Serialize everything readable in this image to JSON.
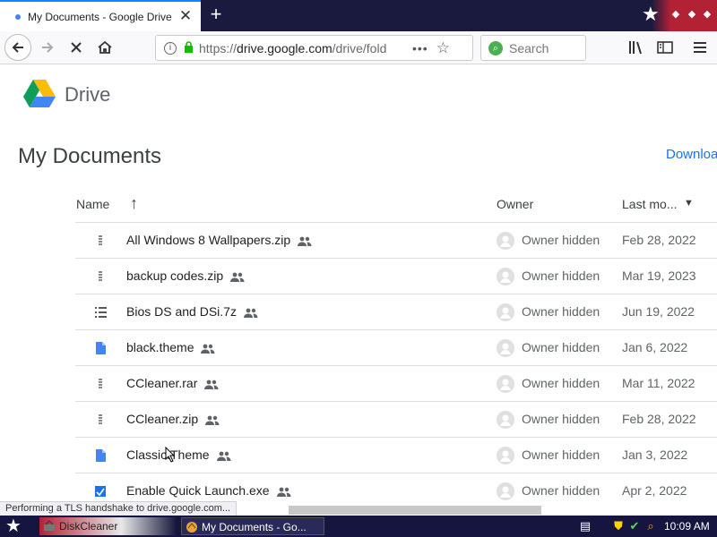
{
  "browser": {
    "tab_title": "My Documents - Google Drive",
    "tab_close": "✕",
    "new_tab": "+",
    "url_prefix": "https://",
    "url_host": "drive.google.com",
    "url_path": "/drive/folde",
    "url_menu": "•••",
    "search_placeholder": "Search"
  },
  "drive": {
    "brand": "Drive",
    "page_title": "My Documents",
    "download_label": "Downloa"
  },
  "columns": {
    "name": "Name",
    "owner": "Owner",
    "last_modified": "Last mo..."
  },
  "files": [
    {
      "name": "All Windows 8 Wallpapers.zip",
      "icon": "zip-icon",
      "owner": "Owner hidden",
      "date": "Feb 28, 2022"
    },
    {
      "name": "backup codes.zip",
      "icon": "zip-icon",
      "owner": "Owner hidden",
      "date": "Mar 19, 2023"
    },
    {
      "name": "Bios DS and DSi.7z",
      "icon": "list-file-icon",
      "owner": "Owner hidden",
      "date": "Jun 19, 2022"
    },
    {
      "name": "black.theme",
      "icon": "doc-icon",
      "owner": "Owner hidden",
      "date": "Jan 6, 2022"
    },
    {
      "name": "CCleaner.rar",
      "icon": "zip-icon",
      "owner": "Owner hidden",
      "date": "Mar 11, 2022"
    },
    {
      "name": "CCleaner.zip",
      "icon": "zip-icon",
      "owner": "Owner hidden",
      "date": "Feb 28, 2022"
    },
    {
      "name": "Classic.Theme",
      "icon": "doc-icon",
      "owner": "Owner hidden",
      "date": "Jan 3, 2022"
    },
    {
      "name": "Enable Quick Launch.exe",
      "icon": "exe-icon",
      "owner": "Owner hidden",
      "date": "Apr 2, 2022"
    }
  ],
  "status_text": "Performing a TLS handshake to drive.google.com...",
  "taskbar": {
    "task1": "DiskCleaner",
    "task2": "My Documents - Go...",
    "clock": "10:09 AM"
  },
  "colors": {
    "accent": "#1a73e8",
    "tab_accent": "#0a84ff",
    "taskbar": "#151540"
  }
}
